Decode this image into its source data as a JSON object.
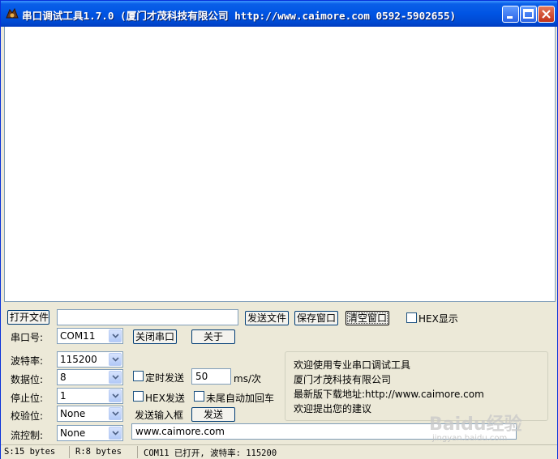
{
  "window": {
    "title": "串口调试工具1.7.0 (厦门才茂科技有限公司 http://www.caimore.com 0592-5902655)",
    "icon": "serial-tool-icon"
  },
  "toolbar": {
    "open_file": "打开文件",
    "file_path": "",
    "send_file": "发送文件",
    "save_window": "保存窗口",
    "clear_window": "清空窗口",
    "hex_display": "HEX显示"
  },
  "port": {
    "label": "串口号:",
    "value": "COM11",
    "close_port": "关闭串口",
    "about": "关于"
  },
  "settings": {
    "baud_label": "波特率:",
    "baud_value": "115200",
    "databits_label": "数据位:",
    "databits_value": "8",
    "stopbits_label": "停止位:",
    "stopbits_value": "1",
    "parity_label": "校验位:",
    "parity_value": "None",
    "flow_label": "流控制:",
    "flow_value": "None"
  },
  "send": {
    "timed_send": "定时发送",
    "interval_value": "50",
    "interval_unit": "ms/次",
    "hex_send": "HEX发送",
    "append_crlf": "未尾自动加回车",
    "input_label": "发送输入框",
    "send_button": "发送",
    "input_value": "www.caimore.com"
  },
  "info": {
    "line1": "欢迎使用专业串口调试工具",
    "line2": "厦门才茂科技有限公司",
    "line3": "最新版下载地址:http://www.caimore.com",
    "line4": "欢迎提出您的建议"
  },
  "status": {
    "sent": "S:15 bytes",
    "received": "R:8 bytes",
    "port_state": "COM11 已打开,  波特率: 115200"
  },
  "watermark": {
    "logo": "Baidu经验",
    "url": "jingyan.baidu.com"
  },
  "colors": {
    "titlebar": "#0054e3",
    "face": "#ece9d8",
    "input_border": "#7f9db9"
  }
}
